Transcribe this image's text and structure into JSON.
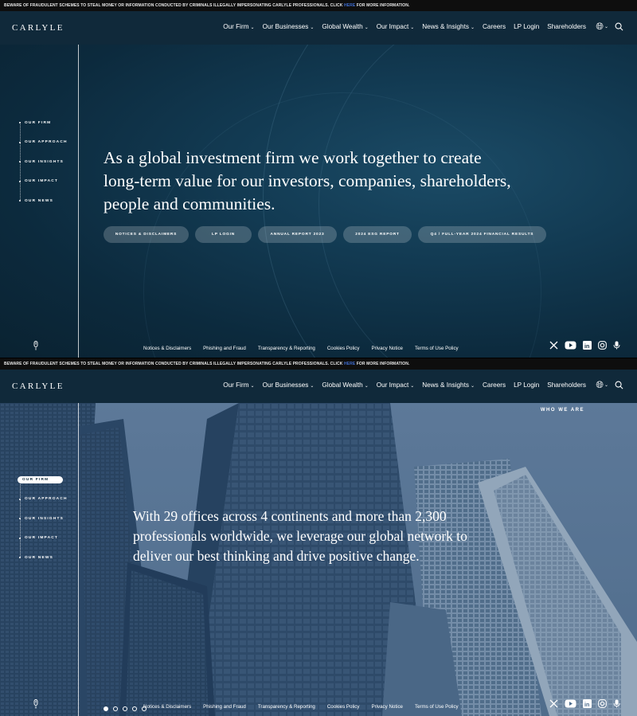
{
  "warning": {
    "pre": "BEWARE OF FRAUDULENT SCHEMES TO STEAL MONEY OR INFORMATION CONDUCTED BY CRIMINALS ILLEGALLY IMPERSONATING CARLYLE PROFESSIONALS. CLICK",
    "link": "HERE",
    "post": "FOR MORE INFORMATION."
  },
  "brand": {
    "logo": "CARLYLE"
  },
  "nav": {
    "items": [
      {
        "label": "Our Firm",
        "dropdown": true
      },
      {
        "label": "Our Businesses",
        "dropdown": true
      },
      {
        "label": "Global Wealth",
        "dropdown": true
      },
      {
        "label": "Our Impact",
        "dropdown": true
      },
      {
        "label": "News & Insights",
        "dropdown": true
      },
      {
        "label": "Careers",
        "dropdown": false
      },
      {
        "label": "LP Login",
        "dropdown": false
      },
      {
        "label": "Shareholders",
        "dropdown": false
      }
    ],
    "language_icon": "globe-icon",
    "search_icon": "search-icon"
  },
  "side_nav": {
    "items": [
      "OUR FIRM",
      "OUR APPROACH",
      "OUR INSIGHTS",
      "OUR IMPACT",
      "OUR NEWS"
    ]
  },
  "section1": {
    "headline": "As a global investment firm we work together to create long-term value for our investors, companies, shareholders, people and communities.",
    "pills": [
      "NOTICES & DISCLAIMERS",
      "LP LOGIN",
      "ANNUAL REPORT 2023",
      "2024 ESG REPORT",
      "Q4 / FULL-YEAR 2024 FINANCIAL RESULTS"
    ]
  },
  "section2": {
    "eyebrow": "WHO WE ARE",
    "headline": "With 29 offices across 4 continents and more than 2,300 professionals worldwide, we leverage our global network to deliver our best thinking and drive positive change.",
    "active_side_item": 0,
    "slide_count": 5,
    "active_slide": 0
  },
  "footer": {
    "links": [
      "Notices & Disclaimers",
      "Phishing and Fraud",
      "Transparency & Reporting",
      "Cookies Policy",
      "Privacy Notice",
      "Terms of Use Policy"
    ],
    "social": [
      "x-icon",
      "youtube-icon",
      "linkedin-icon",
      "instagram-icon",
      "podcast-mic-icon"
    ]
  },
  "colors": {
    "navy": "#10293a",
    "hero_dark": "#0c2a3d",
    "link_blue": "#3f6dd1"
  }
}
